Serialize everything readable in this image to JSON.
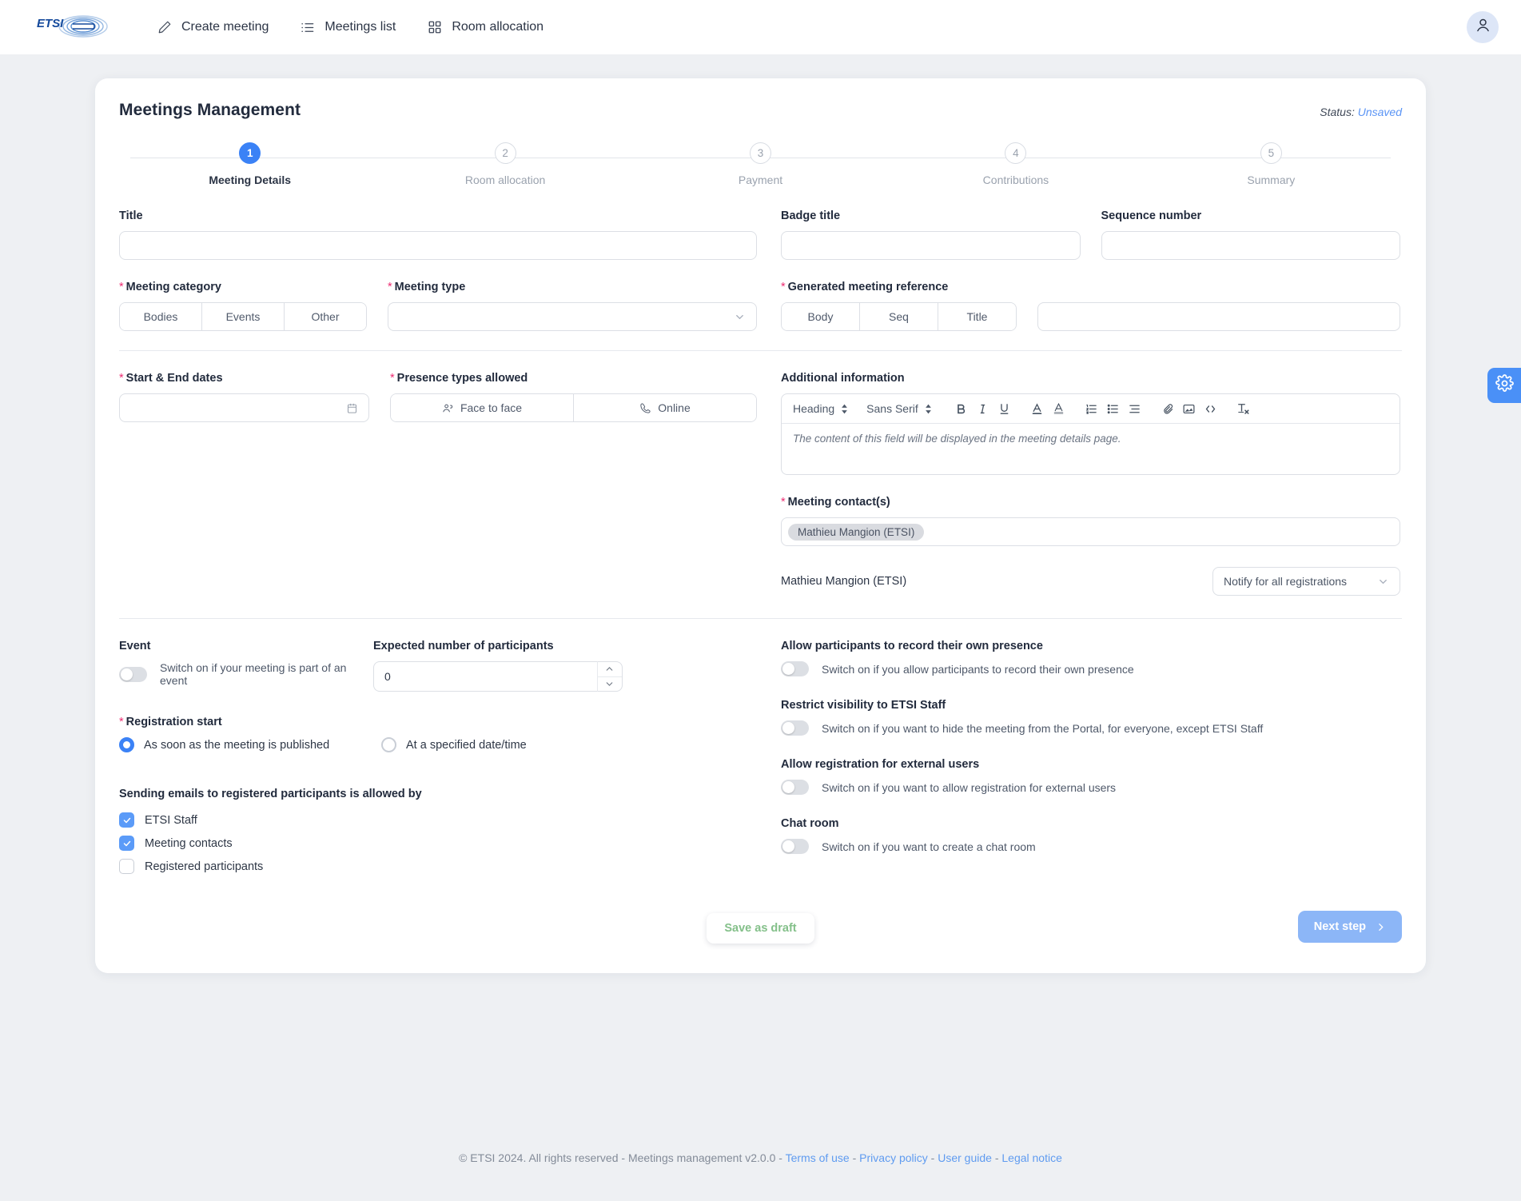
{
  "nav": {
    "logo_text": "ETSI",
    "items": [
      {
        "label": "Create meeting",
        "icon": "pencil-icon"
      },
      {
        "label": "Meetings list",
        "icon": "list-icon"
      },
      {
        "label": "Room allocation",
        "icon": "grid-icon"
      }
    ],
    "avatar_icon": "user-icon"
  },
  "card": {
    "title": "Meetings Management",
    "status_label": "Status:",
    "status_value": "Unsaved"
  },
  "stepper": {
    "steps": [
      {
        "num": "1",
        "label": "Meeting Details"
      },
      {
        "num": "2",
        "label": "Room allocation"
      },
      {
        "num": "3",
        "label": "Payment"
      },
      {
        "num": "4",
        "label": "Contributions"
      },
      {
        "num": "5",
        "label": "Summary"
      }
    ]
  },
  "form": {
    "title_label": "Title",
    "title_value": "",
    "badge_title_label": "Badge title",
    "badge_title_value": "",
    "sequence_label": "Sequence number",
    "sequence_value": "",
    "meeting_category_label": "Meeting category",
    "meeting_category_options": [
      "Bodies",
      "Events",
      "Other"
    ],
    "meeting_type_label": "Meeting type",
    "meeting_type_value": "",
    "generated_ref_label": "Generated meeting reference",
    "generated_ref_options": [
      "Body",
      "Seq",
      "Title"
    ],
    "generated_ref_value": "",
    "dates_label": "Start & End dates",
    "dates_value": "",
    "dates_icon": "calendar-icon",
    "presence_label": "Presence types allowed",
    "presence_options": [
      {
        "label": "Face to face",
        "icon": "people-icon"
      },
      {
        "label": "Online",
        "icon": "phone-icon"
      }
    ],
    "additional_info_label": "Additional information",
    "additional_info_placeholder": "The content of this field will be displayed in the meeting details page.",
    "rte": {
      "heading_select": "Heading",
      "font_select": "Sans Serif",
      "buttons": [
        "bold-icon",
        "italic-icon",
        "underline-icon",
        "text-color-icon",
        "highlight-color-icon",
        "ordered-list-icon",
        "bullet-list-icon",
        "align-icon",
        "link-icon",
        "image-icon",
        "code-icon",
        "clear-format-icon"
      ]
    },
    "contacts_label": "Meeting contact(s)",
    "contacts_chips": [
      "Mathieu Mangion (ETSI)"
    ],
    "contact_rows": [
      {
        "name": "Mathieu Mangion (ETSI)",
        "notify": "Notify for all registrations"
      }
    ],
    "event_label": "Event",
    "event_hint": "Switch on if your meeting is part of an event",
    "expected_label": "Expected number of participants",
    "expected_value": "0",
    "registration_start_label": "Registration start",
    "registration_options": [
      {
        "label": "As soon as the meeting is published",
        "selected": true
      },
      {
        "label": "At a specified date/time",
        "selected": false
      }
    ],
    "emails_label": "Sending emails to registered participants is allowed by",
    "emails_options": [
      {
        "label": "ETSI Staff",
        "checked": true
      },
      {
        "label": "Meeting contacts",
        "checked": true
      },
      {
        "label": "Registered participants",
        "checked": false
      }
    ],
    "record_presence_label": "Allow participants to record their own presence",
    "record_presence_hint": "Switch on if you allow participants to record their own presence",
    "restrict_visibility_label": "Restrict visibility to ETSI Staff",
    "restrict_visibility_hint": "Switch on if you want to hide the meeting from the Portal, for everyone, except ETSI Staff",
    "external_users_label": "Allow registration for external users",
    "external_users_hint": "Switch on if you want to allow registration for external users",
    "chat_room_label": "Chat room",
    "chat_room_hint": "Switch on if you want to create a chat room"
  },
  "actions": {
    "save_draft": "Save as draft",
    "next_step": "Next step",
    "next_icon": "chevron-right-icon"
  },
  "side_tab": {
    "icon": "gear-icon"
  },
  "footer": {
    "copyright": "© ETSI 2024. All rights reserved - Meetings management v2.0.0 -",
    "links": [
      "Terms of use",
      "Privacy policy",
      "User guide",
      "Legal notice"
    ],
    "separator": "-"
  },
  "colors": {
    "accent": "#3b82f6",
    "required": "#ec2c72",
    "draft_green": "#84c08a",
    "next_blue": "#8cb6f7"
  }
}
